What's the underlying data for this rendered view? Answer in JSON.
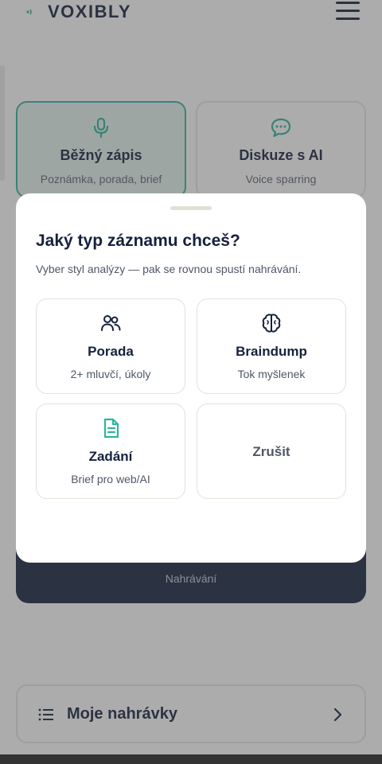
{
  "app": {
    "brand": "VOXIBLY"
  },
  "icons": {
    "logo": "audio-wave-icon",
    "menu": "hamburger-menu-icon",
    "mode_1": "microphone-icon",
    "mode_2": "chat-bubble-icon",
    "recordings": "list-icon",
    "recordings_chevron": "chevron-right-icon",
    "option_1": "users-icon",
    "option_2": "brain-icon",
    "option_3": "document-icon"
  },
  "colors": {
    "primary": "#15213d",
    "accent": "#2fb59c"
  },
  "modes": [
    {
      "title": "Běžný zápis",
      "subtitle": "Poznámka, porada, brief",
      "selected": true
    },
    {
      "title": "Diskuze s AI",
      "subtitle": "Voice sparring",
      "selected": false
    }
  ],
  "recorder": {
    "status_label": "Nahrávání"
  },
  "recordings": {
    "label": "Moje nahrávky"
  },
  "sheet": {
    "title": "Jaký typ záznamu chceš?",
    "subtitle": "Vyber styl analýzy — pak se rovnou spustí nahrávání.",
    "options": [
      {
        "title": "Porada",
        "subtitle": "2+ mluvčí, úkoly"
      },
      {
        "title": "Braindump",
        "subtitle": "Tok myšlenek"
      },
      {
        "title": "Zadání",
        "subtitle": "Brief pro web/AI"
      }
    ],
    "cancel_label": "Zrušit"
  }
}
